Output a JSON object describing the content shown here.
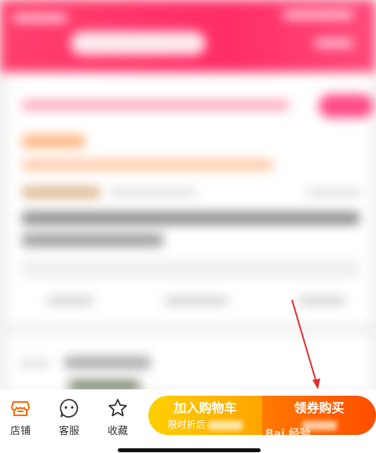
{
  "bottom_bar": {
    "store_label": "店铺",
    "service_label": "客服",
    "favorite_label": "收藏",
    "cart_button": {
      "label": "加入购物车",
      "sub_label": "限时折后"
    },
    "buy_button": {
      "label": "领券购买"
    }
  },
  "watermark": "Bai 经验",
  "colors": {
    "header": "#ff2d66",
    "cart_button": "#ffb000",
    "buy_button": "#ff5a00",
    "store_icon": "#ff6a00",
    "annotation_arrow": "#e03030"
  }
}
